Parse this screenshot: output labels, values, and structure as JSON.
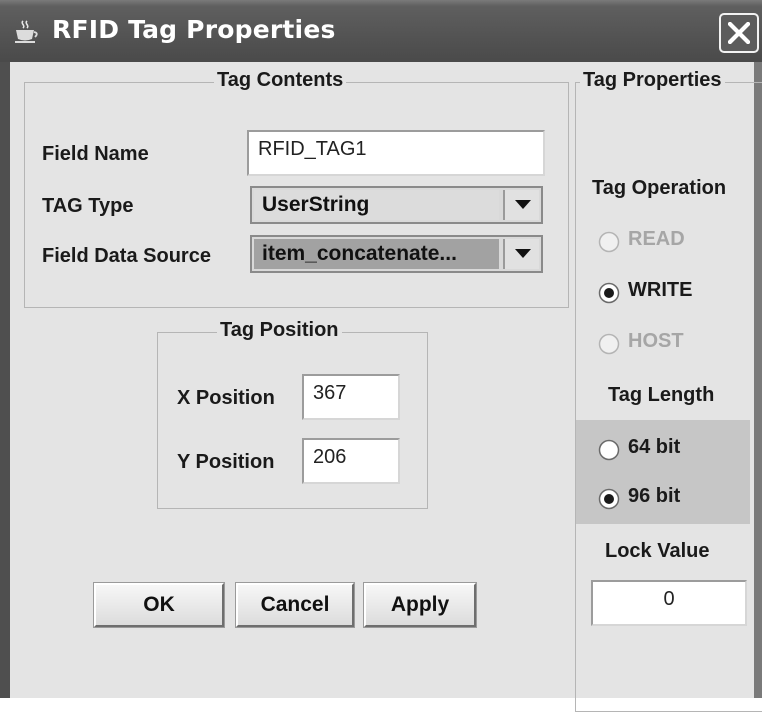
{
  "window": {
    "title": "RFID Tag Properties"
  },
  "tag_contents": {
    "legend": "Tag Contents",
    "field_name": {
      "label": "Field Name",
      "value": "RFID_TAG1"
    },
    "tag_type": {
      "label": "TAG Type",
      "value": "UserString"
    },
    "field_data_source": {
      "label": "Field Data Source",
      "value": "item_concatenate..."
    }
  },
  "tag_position": {
    "legend": "Tag Position",
    "x": {
      "label": "X Position",
      "value": "367"
    },
    "y": {
      "label": "Y Position",
      "value": "206"
    }
  },
  "tag_properties": {
    "legend": "Tag Properties",
    "operation": {
      "label": "Tag Operation",
      "options": [
        {
          "label": "READ",
          "selected": false,
          "enabled": false
        },
        {
          "label": "WRITE",
          "selected": true,
          "enabled": true
        },
        {
          "label": "HOST",
          "selected": false,
          "enabled": false
        }
      ]
    },
    "length": {
      "label": "Tag Length",
      "options": [
        {
          "label": "64 bit",
          "selected": false,
          "enabled": true
        },
        {
          "label": "96 bit",
          "selected": true,
          "enabled": true
        }
      ]
    },
    "lock": {
      "label": "Lock Value",
      "value": "0"
    }
  },
  "buttons": {
    "ok": "OK",
    "cancel": "Cancel",
    "apply": "Apply"
  },
  "icons": {
    "app": "java-cup-icon",
    "close": "close-icon",
    "dropdown": "chevron-down-icon",
    "radio": "radio-button-icon"
  },
  "colors": {
    "titlebar": "#535353",
    "panel": "#e4e4e4",
    "highlight_panel": "#c6c6c6",
    "field_bg": "#ffffff",
    "disabled_text": "#a6a6a6"
  }
}
